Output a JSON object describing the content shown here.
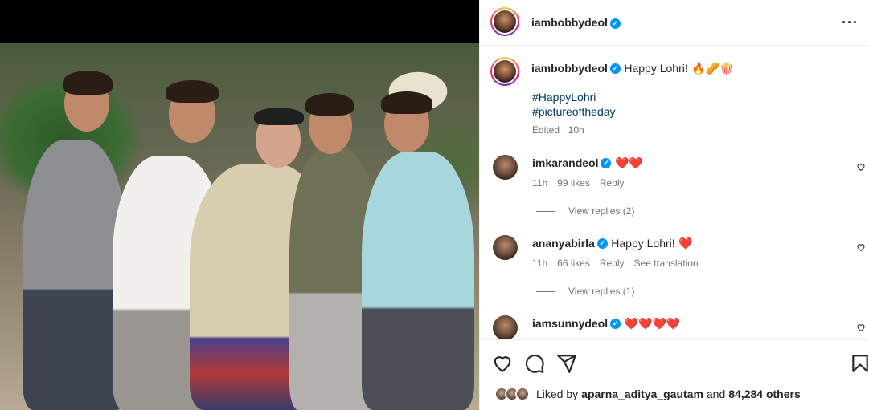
{
  "post": {
    "author": "iambobbydeol",
    "caption": "Happy Lohri!",
    "caption_emojis": "🔥🥜🍿",
    "hashtags": [
      "#HappyLohri",
      "#pictureoftheday"
    ],
    "edited": "Edited · 10h"
  },
  "comments": [
    {
      "user": "imkarandeol",
      "text": "",
      "emojis": "❤️❤️",
      "time": "11h",
      "likes": "99 likes",
      "reply": "Reply",
      "translation": "",
      "view_replies": "View replies (2)"
    },
    {
      "user": "ananyabirla",
      "text": "Happy Lohri!",
      "emojis": "❤️",
      "time": "11h",
      "likes": "66 likes",
      "reply": "Reply",
      "translation": "See translation",
      "view_replies": "View replies (1)"
    },
    {
      "user": "iamsunnydeol",
      "text": "",
      "emojis": "❤️❤️❤️❤️",
      "time": "",
      "likes": "",
      "reply": "",
      "translation": "",
      "view_replies": ""
    }
  ],
  "likes": {
    "prefix": "Liked by",
    "user": "aparna_aditya_gautam",
    "joiner": "and",
    "others": "84,284 others"
  },
  "icons": [
    "more-icon",
    "verified-icon",
    "heart-icon",
    "comment-icon",
    "share-icon",
    "bookmark-icon"
  ],
  "colors": {
    "link": "#00376b",
    "verified": "#0095f6",
    "muted": "#737373",
    "heart": "#ed4956"
  }
}
